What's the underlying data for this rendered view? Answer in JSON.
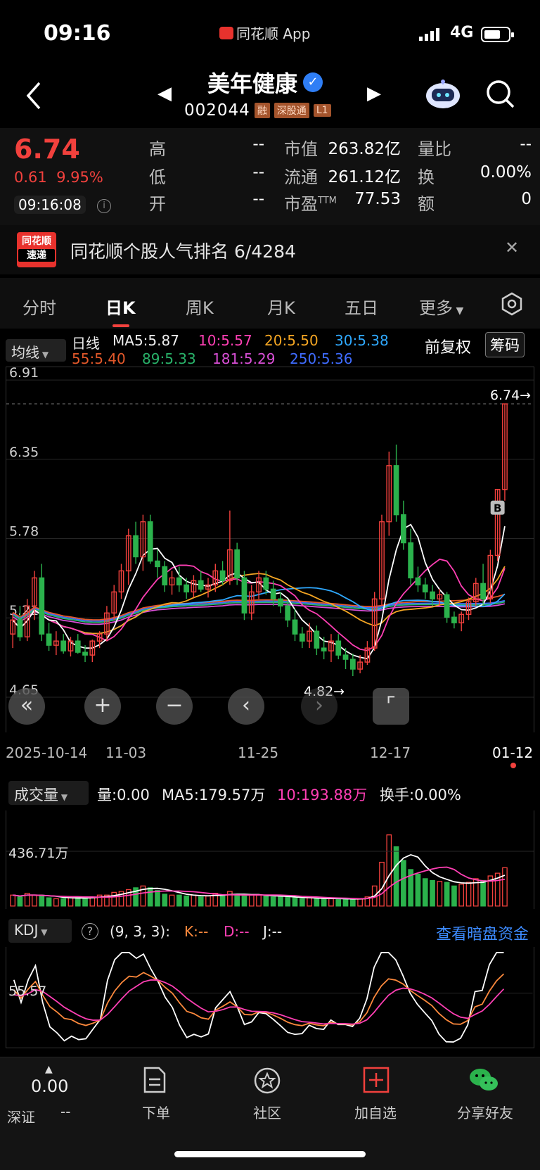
{
  "status_bar": {
    "time": "09:16",
    "app": "同花顺 App",
    "network": "4G"
  },
  "header": {
    "stock_name": "美年健康",
    "stock_code": "002044",
    "tags": [
      "融",
      "深股通",
      "L1"
    ]
  },
  "quote": {
    "price": "6.74",
    "change": "0.61",
    "change_pct": "9.95%",
    "time": "09:16:08",
    "high_label": "高",
    "high_value": "--",
    "low_label": "低",
    "low_value": "--",
    "open_label": "开",
    "open_value": "--",
    "mktcap_label": "市值",
    "mktcap_value": "263.82亿",
    "float_label": "流通",
    "float_value": "261.12亿",
    "pe_label": "市盈",
    "pe_suffix": "TTM",
    "pe_value": "77.53",
    "vol_ratio_label": "量比",
    "vol_ratio_value": "--",
    "turnover_label": "换",
    "turnover_value": "0.00%",
    "amount_label": "额",
    "amount_value": "0"
  },
  "banner": {
    "logo_line1": "同花顺",
    "logo_line2": "速递",
    "text": "同花顺个股人气排名 6/4284"
  },
  "tabs": [
    "分时",
    "日K",
    "周K",
    "月K",
    "五日",
    "更多"
  ],
  "active_tab": "日K",
  "ma_legend": {
    "select": "均线",
    "period": "日线",
    "ma5": "MA5:5.87",
    "ma10": "10:5.57",
    "ma20": "20:5.50",
    "ma30": "30:5.38",
    "ma55": "55:5.40",
    "ma89": "89:5.33",
    "ma181": "181:5.29",
    "ma250": "250:5.36",
    "adjust": "前复权",
    "chip_button": "筹码"
  },
  "colors": {
    "up": "#f2413d",
    "down": "#2bb24c",
    "ma5": "#ffffff",
    "ma10": "#ff3fb4",
    "ma20": "#f5a623",
    "ma30": "#2fa9ff",
    "ma55": "#e2582a",
    "ma89": "#29b36a",
    "ma181": "#d94fd6",
    "ma250": "#3f6cff"
  },
  "main_chart": {
    "y_labels": [
      "6.91",
      "6.35",
      "5.78",
      "5.21",
      "4.65"
    ],
    "last_price_mark": "6.74→",
    "low_mark": "4.82→",
    "buy_marker": "B"
  },
  "dates": [
    "2025-10-14",
    "11-03",
    "11-25",
    "12-17",
    "01-12"
  ],
  "volume": {
    "select": "成交量",
    "vol": "量:0.00",
    "ma5": "MA5:179.57万",
    "ma10": "10:193.88万",
    "turnover": "换手:0.00%",
    "y_label": "436.71万"
  },
  "kdj": {
    "select": "KDJ",
    "params": "(9, 3, 3):",
    "k": "K:--",
    "d": "D:--",
    "j": "J:--",
    "link": "查看暗盘资金",
    "y_label": "55.57"
  },
  "bottom_nav": {
    "market_value": "0.00",
    "market_label": "深证",
    "market_change": "--",
    "order": "下单",
    "community": "社区",
    "add_watch": "加自选",
    "share": "分享好友"
  },
  "chart_data": {
    "type": "candlestick",
    "ylim": [
      4.65,
      6.91
    ],
    "candles": [
      [
        5.1,
        5.25,
        5.0,
        5.2
      ],
      [
        5.2,
        5.3,
        5.05,
        5.08
      ],
      [
        5.08,
        5.35,
        5.05,
        5.3
      ],
      [
        5.3,
        5.55,
        5.2,
        5.5
      ],
      [
        5.5,
        5.6,
        5.05,
        5.1
      ],
      [
        5.1,
        5.18,
        4.98,
        5.02
      ],
      [
        5.02,
        5.12,
        4.95,
        5.05
      ],
      [
        5.05,
        5.1,
        4.96,
        4.98
      ],
      [
        4.98,
        5.08,
        4.94,
        5.05
      ],
      [
        5.05,
        5.1,
        4.96,
        4.97
      ],
      [
        4.97,
        5.02,
        4.9,
        4.95
      ],
      [
        4.95,
        5.06,
        4.9,
        5.05
      ],
      [
        5.05,
        5.12,
        5.0,
        5.1
      ],
      [
        5.1,
        5.3,
        5.05,
        5.25
      ],
      [
        5.25,
        5.45,
        5.2,
        5.4
      ],
      [
        5.4,
        5.6,
        5.35,
        5.55
      ],
      [
        5.55,
        5.85,
        5.45,
        5.8
      ],
      [
        5.8,
        5.9,
        5.6,
        5.65
      ],
      [
        5.65,
        5.95,
        5.55,
        5.9
      ],
      [
        5.9,
        5.95,
        5.6,
        5.62
      ],
      [
        5.62,
        5.7,
        5.5,
        5.58
      ],
      [
        5.58,
        5.62,
        5.4,
        5.45
      ],
      [
        5.45,
        5.55,
        5.38,
        5.5
      ],
      [
        5.5,
        5.58,
        5.4,
        5.45
      ],
      [
        5.45,
        5.5,
        5.35,
        5.4
      ],
      [
        5.4,
        5.52,
        5.36,
        5.48
      ],
      [
        5.48,
        5.55,
        5.4,
        5.42
      ],
      [
        5.42,
        5.5,
        5.36,
        5.45
      ],
      [
        5.45,
        5.6,
        5.4,
        5.55
      ],
      [
        5.55,
        5.62,
        5.45,
        5.48
      ],
      [
        5.48,
        5.98,
        5.45,
        5.7
      ],
      [
        5.7,
        5.75,
        5.45,
        5.5
      ],
      [
        5.5,
        5.55,
        5.2,
        5.25
      ],
      [
        5.25,
        5.45,
        5.2,
        5.4
      ],
      [
        5.4,
        5.55,
        5.35,
        5.5
      ],
      [
        5.5,
        5.55,
        5.38,
        5.42
      ],
      [
        5.42,
        5.48,
        5.3,
        5.35
      ],
      [
        5.35,
        5.4,
        5.25,
        5.3
      ],
      [
        5.3,
        5.35,
        5.15,
        5.2
      ],
      [
        5.2,
        5.28,
        5.05,
        5.1
      ],
      [
        5.1,
        5.15,
        5.0,
        5.05
      ],
      [
        5.05,
        5.18,
        5.0,
        5.12
      ],
      [
        5.12,
        5.16,
        4.95,
        5.0
      ],
      [
        5.0,
        5.08,
        4.92,
        4.98
      ],
      [
        4.98,
        5.1,
        4.9,
        5.05
      ],
      [
        5.05,
        5.1,
        4.92,
        4.95
      ],
      [
        4.95,
        5.0,
        4.85,
        4.92
      ],
      [
        4.92,
        4.96,
        4.8,
        4.85
      ],
      [
        4.85,
        4.95,
        4.82,
        4.9
      ],
      [
        4.9,
        5.05,
        4.88,
        5.0
      ],
      [
        5.0,
        5.4,
        4.98,
        5.35
      ],
      [
        5.35,
        5.95,
        5.3,
        5.9
      ],
      [
        5.9,
        6.4,
        5.8,
        6.3
      ],
      [
        6.3,
        6.45,
        5.9,
        5.95
      ],
      [
        5.95,
        6.05,
        5.7,
        5.75
      ],
      [
        5.75,
        5.85,
        5.45,
        5.5
      ],
      [
        5.5,
        5.58,
        5.4,
        5.45
      ],
      [
        5.45,
        5.5,
        5.35,
        5.4
      ],
      [
        5.4,
        5.45,
        5.3,
        5.35
      ],
      [
        5.35,
        5.42,
        5.3,
        5.38
      ],
      [
        5.38,
        5.4,
        5.18,
        5.22
      ],
      [
        5.22,
        5.26,
        5.14,
        5.18
      ],
      [
        5.18,
        5.26,
        5.12,
        5.24
      ],
      [
        5.24,
        5.36,
        5.2,
        5.33
      ],
      [
        5.33,
        5.5,
        5.3,
        5.46
      ],
      [
        5.46,
        5.6,
        5.3,
        5.35
      ],
      [
        5.35,
        5.7,
        5.32,
        5.66
      ],
      [
        5.66,
        6.13,
        5.62,
        6.13
      ],
      [
        6.13,
        6.74,
        6.05,
        6.74
      ]
    ],
    "volume_ratio": [
      0.12,
      0.1,
      0.14,
      0.12,
      0.11,
      0.09,
      0.08,
      0.08,
      0.09,
      0.1,
      0.09,
      0.09,
      0.12,
      0.12,
      0.15,
      0.16,
      0.18,
      0.2,
      0.22,
      0.2,
      0.17,
      0.13,
      0.12,
      0.12,
      0.11,
      0.12,
      0.1,
      0.11,
      0.14,
      0.12,
      0.16,
      0.12,
      0.11,
      0.12,
      0.12,
      0.11,
      0.1,
      0.1,
      0.1,
      0.09,
      0.08,
      0.09,
      0.08,
      0.08,
      0.08,
      0.08,
      0.08,
      0.07,
      0.08,
      0.1,
      0.22,
      0.48,
      0.78,
      0.65,
      0.5,
      0.4,
      0.35,
      0.3,
      0.28,
      0.27,
      0.26,
      0.22,
      0.24,
      0.26,
      0.3,
      0.28,
      0.33,
      0.36,
      0.42
    ]
  }
}
